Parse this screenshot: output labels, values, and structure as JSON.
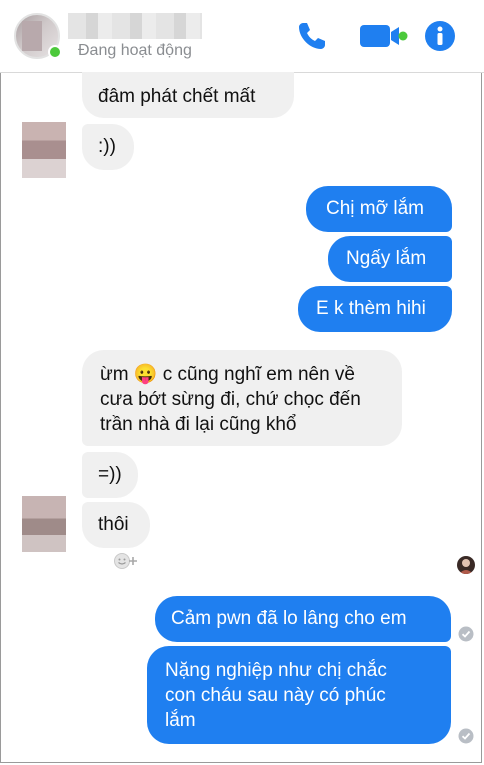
{
  "header": {
    "status": "Đang hoạt động",
    "colors": {
      "accent": "#1f7ff0",
      "online": "#4cc93b"
    }
  },
  "messages": [
    {
      "side": "in",
      "text": "đâm phát chết mất"
    },
    {
      "side": "in",
      "text": ":))"
    },
    {
      "side": "out",
      "text": "Chị mỡ lắm"
    },
    {
      "side": "out",
      "text": "Ngấy lắm"
    },
    {
      "side": "out",
      "text": "E k thèm hihi"
    },
    {
      "side": "in",
      "text": "ừm 😛 c cũng nghĩ em nên về\ncưa bớt sừng đi, chứ chọc đến\ntrần nhà đi lại cũng khổ"
    },
    {
      "side": "in",
      "text": "=))"
    },
    {
      "side": "in",
      "text": "thôi"
    },
    {
      "side": "out",
      "text": "Cảm pwn đã lo lâng cho em"
    },
    {
      "side": "out",
      "text": "Nặng nghiệp như chị chắc\ncon cháu sau này có phúc\nlắm"
    }
  ]
}
